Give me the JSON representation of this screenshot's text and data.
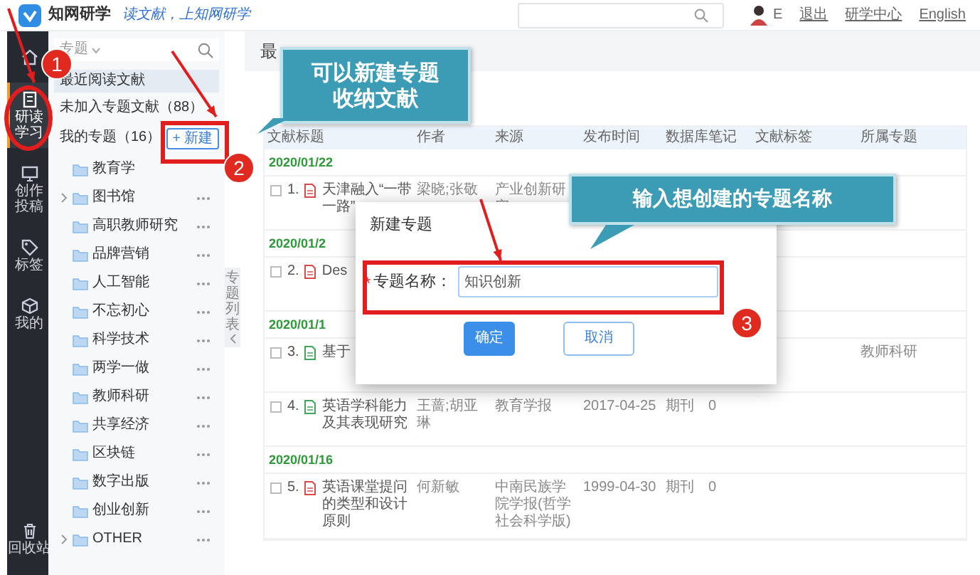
{
  "header": {
    "app_name": "知网研学",
    "slogan": "读文献，上知网研学",
    "user_name": "E",
    "links": [
      "退出",
      "研学中心",
      "English"
    ]
  },
  "nav": [
    {
      "selected": false
    },
    {
      "label": "研读学习",
      "selected": true
    },
    {
      "label": "创作投稿",
      "selected": false
    },
    {
      "label": "标签",
      "selected": false
    },
    {
      "label": "我的",
      "selected": false
    }
  ],
  "trash": {
    "label": "回收站"
  },
  "topic_panel": {
    "search_scope": "专题",
    "items": [
      {
        "label": "最近阅读文献",
        "selected": true
      },
      {
        "label": "未加入专题文献（88）",
        "selected": false
      }
    ],
    "my_topics": {
      "label": "我的专题（16）",
      "new_button": "+ 新建"
    },
    "folders": [
      {
        "name": "教育学",
        "expandable": false,
        "has_menu": false
      },
      {
        "name": "图书馆",
        "expandable": true,
        "has_menu": true
      },
      {
        "name": "高职教师研究",
        "expandable": false,
        "has_menu": true
      },
      {
        "name": "品牌营销",
        "expandable": false,
        "has_menu": true
      },
      {
        "name": "人工智能",
        "expandable": false,
        "has_menu": true
      },
      {
        "name": "不忘初心",
        "expandable": false,
        "has_menu": true
      },
      {
        "name": "科学技术",
        "expandable": false,
        "has_menu": true
      },
      {
        "name": "两学一做",
        "expandable": false,
        "has_menu": true
      },
      {
        "name": "教师科研",
        "expandable": false,
        "has_menu": true
      },
      {
        "name": "共享经济",
        "expandable": false,
        "has_menu": true
      },
      {
        "name": "区块链",
        "expandable": false,
        "has_menu": true
      },
      {
        "name": "数字出版",
        "expandable": false,
        "has_menu": true
      },
      {
        "name": "创业创新",
        "expandable": false,
        "has_menu": true
      },
      {
        "name": "OTHER",
        "expandable": true,
        "has_menu": true
      }
    ]
  },
  "side_tab": {
    "label": "专题列表"
  },
  "main": {
    "title": "最",
    "table": {
      "columns": [
        "文献标题",
        "作者",
        "来源",
        "发布时间",
        "数据库",
        "笔记",
        "文献标签",
        "所属专题"
      ],
      "groups": [
        {
          "date": "2020/01/22",
          "rows": [
            {
              "number": "1.",
              "color": "#e04848",
              "checked": false,
              "cells": [
                "天津融入“一带一路”",
                "梁晓;张敬",
                "产业创新研究"
              ]
            }
          ]
        },
        {
          "date": "2020/01/2",
          "rows": [
            {
              "number": "2.",
              "color": "#e04848",
              "checked": false,
              "cells": [
                "Des"
              ]
            }
          ]
        },
        {
          "date": "2020/01/1",
          "rows": [
            {
              "number": "3.",
              "color": "#3ea85a",
              "checked": false,
              "cells": [
                "基于",
                "",
                "",
                "",
                "",
                "",
                "",
                "教师科研"
              ]
            },
            {
              "number": "4.",
              "color": "#3ea85a",
              "checked": false,
              "cells": [
                "英语学科能力及其表现研究",
                "王蔷;胡亚琳",
                "教育学报",
                "2017-04-25",
                "期刊",
                "0"
              ]
            }
          ]
        },
        {
          "date": "2020/01/16",
          "rows": [
            {
              "number": "5.",
              "color": "#e04848",
              "checked": false,
              "cells": [
                "英语课堂提问的类型和设计原则",
                "何新敏",
                "中南民族学院学报(哲学社会科学版)",
                "1999-04-30",
                "期刊",
                "0"
              ]
            }
          ]
        }
      ]
    }
  },
  "dialog": {
    "title": "新建专题",
    "field": {
      "required_mark": "*",
      "label": "专题名称：",
      "value": "知识创新"
    },
    "buttons": [
      {
        "label": "确定",
        "kind": "primary"
      },
      {
        "label": "取消",
        "kind": "secondary"
      }
    ]
  },
  "annotations": {
    "callouts": [
      {
        "lines": [
          "可以新建专题",
          "收纳文献"
        ]
      },
      {
        "lines": [
          "输入想创建的专题名称"
        ]
      }
    ],
    "markers": [
      "1",
      "2",
      "3"
    ]
  }
}
